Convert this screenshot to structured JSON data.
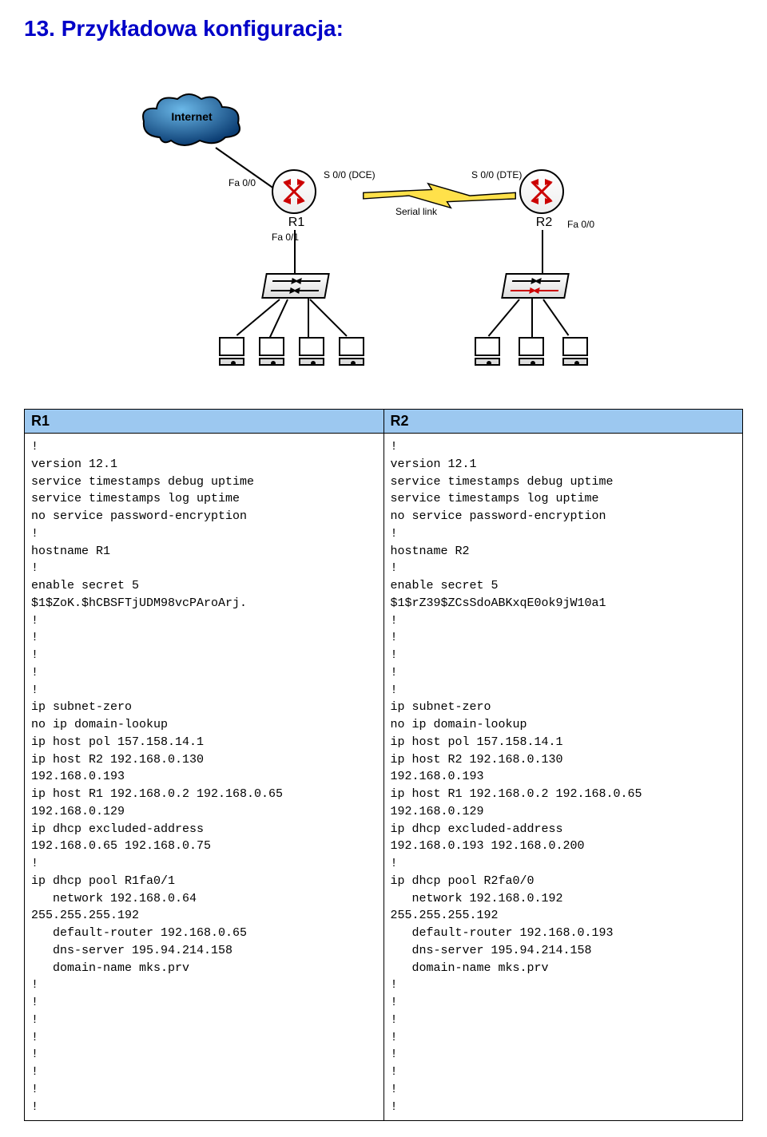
{
  "title": "13.  Przykładowa konfiguracja:",
  "cloud_label": "Internet",
  "routers": {
    "r1": "R1",
    "r2": "R2"
  },
  "interface_labels": {
    "fa00_left": "Fa 0/0",
    "s00_dce": "S 0/0 (DCE)",
    "fa01": "Fa 0/1",
    "serial_link": "Serial link",
    "s00_dte": "S 0/0 (DTE)",
    "fa00_right": "Fa 0/0"
  },
  "table": {
    "header_r1": "R1",
    "header_r2": "R2",
    "r1_config": "!\nversion 12.1\nservice timestamps debug uptime\nservice timestamps log uptime\nno service password-encryption\n!\nhostname R1\n!\nenable secret 5\n$1$ZoK.$hCBSFTjUDM98vcPAroArj.\n!\n!\n!\n!\n!\nip subnet-zero\nno ip domain-lookup\nip host pol 157.158.14.1\nip host R2 192.168.0.130\n192.168.0.193\nip host R1 192.168.0.2 192.168.0.65\n192.168.0.129\nip dhcp excluded-address\n192.168.0.65 192.168.0.75\n!\nip dhcp pool R1fa0/1\n   network 192.168.0.64\n255.255.255.192\n   default-router 192.168.0.65\n   dns-server 195.94.214.158\n   domain-name mks.prv\n!\n!\n!\n!\n!\n!\n!\n!",
    "r2_config": "!\nversion 12.1\nservice timestamps debug uptime\nservice timestamps log uptime\nno service password-encryption\n!\nhostname R2\n!\nenable secret 5\n$1$rZ39$ZCsSdoABKxqE0ok9jW10a1\n!\n!\n!\n!\n!\nip subnet-zero\nno ip domain-lookup\nip host pol 157.158.14.1\nip host R2 192.168.0.130\n192.168.0.193\nip host R1 192.168.0.2 192.168.0.65\n192.168.0.129\nip dhcp excluded-address\n192.168.0.193 192.168.0.200\n!\nip dhcp pool R2fa0/0\n   network 192.168.0.192\n255.255.255.192\n   default-router 192.168.0.193\n   dns-server 195.94.214.158\n   domain-name mks.prv\n!\n!\n!\n!\n!\n!\n!\n!"
  }
}
